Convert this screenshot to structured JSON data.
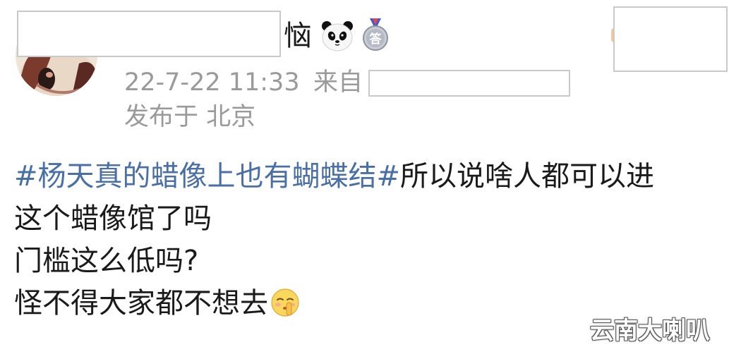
{
  "header": {
    "name_suffix": "恼",
    "badges": [
      "panda-icon",
      "medal-icon"
    ],
    "medal_text": "答"
  },
  "meta": {
    "time": "22-7-22 11:33",
    "from_label": "来自",
    "location": "发布于 北京"
  },
  "post": {
    "hashtag": "#杨天真的蜡像上也有蝴蝶结#",
    "line1_rest": "所以说啥人都可以进",
    "line2": "这个蜡像馆了吗",
    "line3": "门槛这么低吗?",
    "line4": "怪不得大家都不想去",
    "emoji": "shushing-face-emoji"
  },
  "watermark": "云南大喇叭",
  "colors": {
    "hashtag": "#4a6fa5",
    "meta": "#9a9a9a",
    "text": "#1a1a1a",
    "redact_border": "#c9c9c9"
  }
}
